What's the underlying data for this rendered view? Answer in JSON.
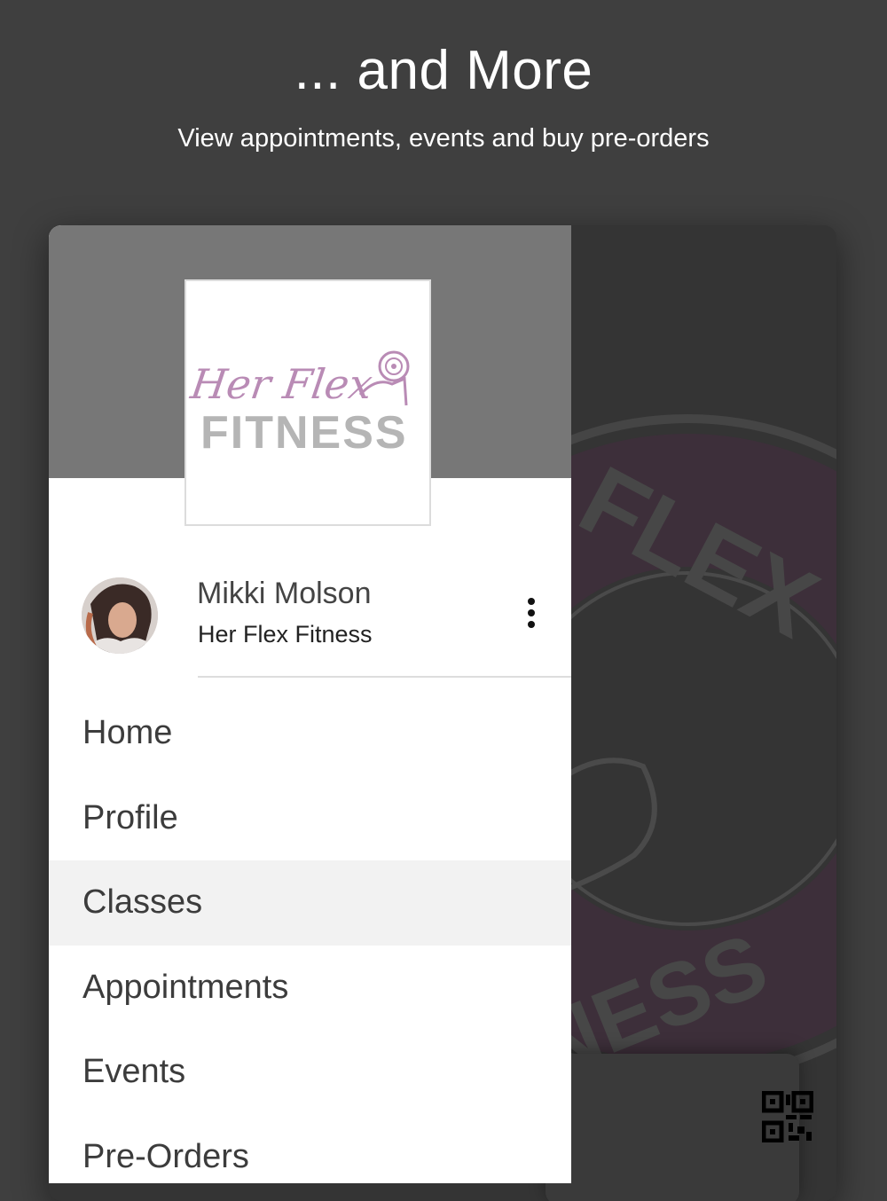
{
  "hero": {
    "title": "... and More",
    "subtitle": "View appointments, events and buy pre-orders"
  },
  "drawer": {
    "logo": {
      "script_text": "Her Flex",
      "block_text": "FITNESS"
    },
    "user": {
      "name": "Mikki Molson",
      "organization": "Her Flex Fitness"
    },
    "menu": [
      {
        "label": "Home",
        "active": false
      },
      {
        "label": "Profile",
        "active": false
      },
      {
        "label": "Classes",
        "active": true
      },
      {
        "label": "Appointments",
        "active": false
      },
      {
        "label": "Events",
        "active": false
      },
      {
        "label": "Pre-Orders",
        "active": false
      }
    ]
  },
  "background": {
    "logo_text_top": "FLEX",
    "logo_text_bottom": "NESS"
  },
  "colors": {
    "page_bg": "#3f3f3f",
    "drawer_header": "#777777",
    "logo_pink": "#b98bb5",
    "logo_grey": "#b5b5b5",
    "active_item_bg": "#f2f2f2"
  },
  "icons": {
    "more": "more-vertical-icon",
    "qr": "qr-code-icon"
  }
}
